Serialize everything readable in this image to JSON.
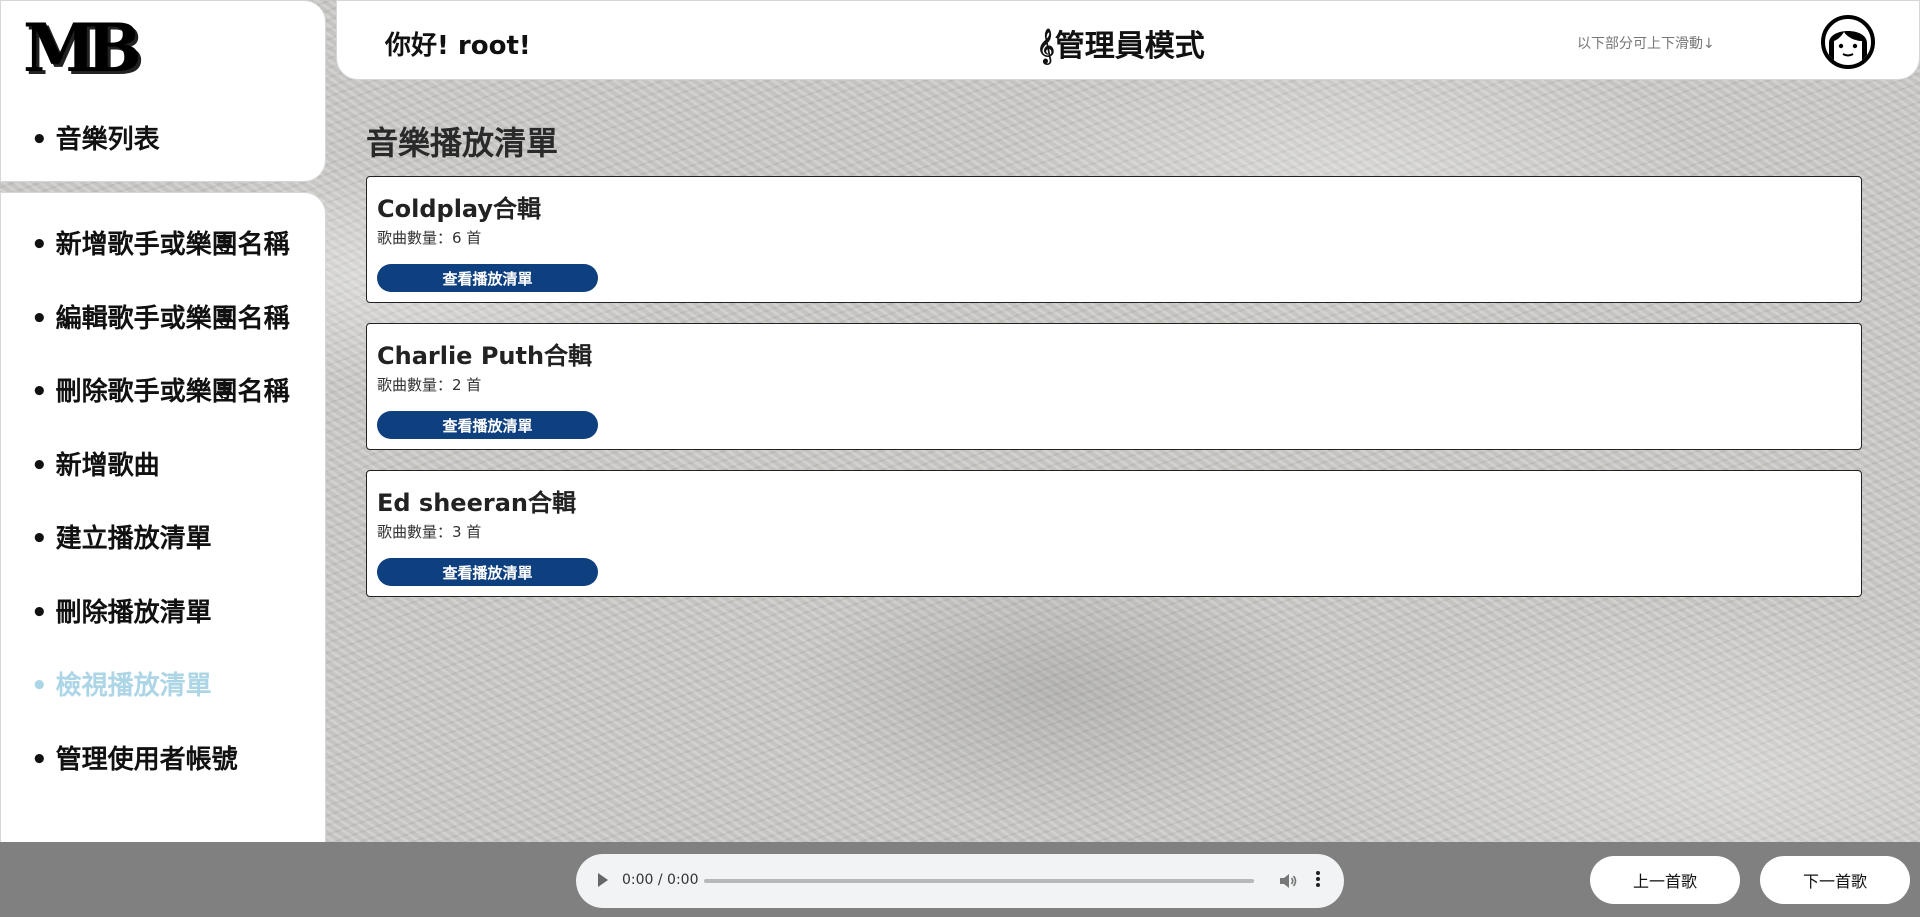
{
  "app": {
    "logo_text": "MB"
  },
  "sidebar": {
    "top_item": "音樂列表",
    "items": [
      {
        "label": "新增歌手或樂團名稱",
        "active": false
      },
      {
        "label": "編輯歌手或樂團名稱",
        "active": false
      },
      {
        "label": "刪除歌手或樂團名稱",
        "active": false
      },
      {
        "label": "新增歌曲",
        "active": false
      },
      {
        "label": "建立播放清單",
        "active": false
      },
      {
        "label": "刪除播放清單",
        "active": false
      },
      {
        "label": "檢視播放清單",
        "active": true
      },
      {
        "label": "管理使用者帳號",
        "active": false
      }
    ],
    "active_color": "#acd5e6"
  },
  "header": {
    "greeting": "你好! root!",
    "mode_title": "𝄞管理員模式",
    "scroll_hint": "以下部分可上下滑動↓",
    "avatar_icon": "user-avatar-icon"
  },
  "main": {
    "section_title": "音樂播放清單",
    "playlists": [
      {
        "title": "Coldplay合輯",
        "count": "歌曲數量：6 首",
        "button": "查看播放清單"
      },
      {
        "title": "Charlie Puth合輯",
        "count": "歌曲數量：2 首",
        "button": "查看播放清單"
      },
      {
        "title": "Ed sheeran合輯",
        "count": "歌曲數量：3 首",
        "button": "查看播放清單"
      }
    ],
    "button_color": "#0e3f7e"
  },
  "player": {
    "time": "0:00 / 0:00",
    "prev_label": "上一首歌",
    "next_label": "下一首歌",
    "bar_color": "#808080"
  }
}
